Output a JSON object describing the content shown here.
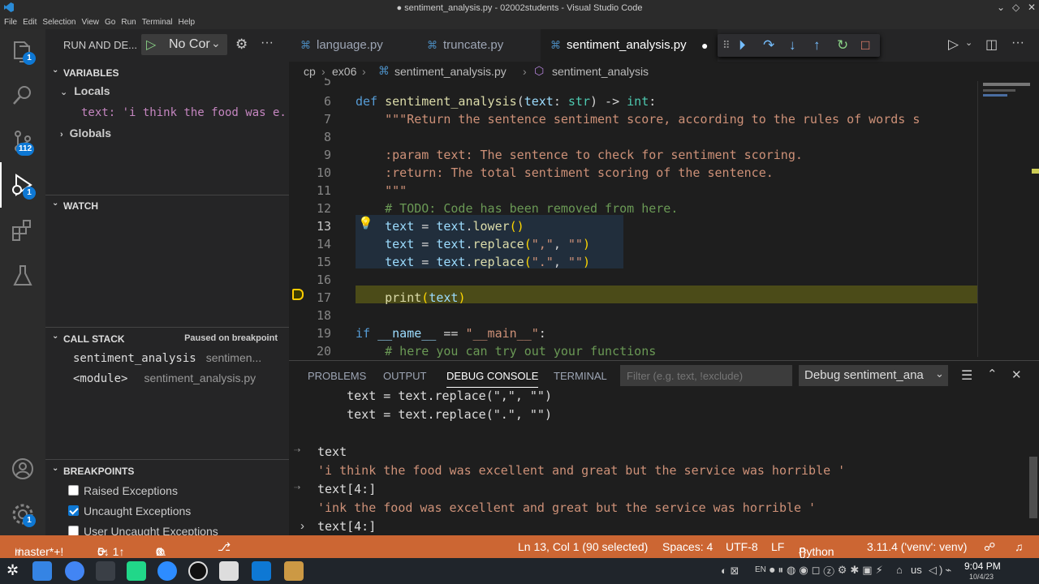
{
  "window": {
    "title": "● sentiment_analysis.py - 02002students - Visual Studio Code"
  },
  "menu": [
    "File",
    "Edit",
    "Selection",
    "View",
    "Go",
    "Run",
    "Terminal",
    "Help"
  ],
  "activity": {
    "explorer_badge": "1",
    "scm_badge": "112",
    "debug_badge": "1",
    "settings_badge": "1"
  },
  "sidebar": {
    "run_title": "RUN AND DE...",
    "config": "No Cor",
    "variables_header": "VARIABLES",
    "locals_label": "Locals",
    "local_var": "text: 'i think the food was e...",
    "globals_label": "Globals",
    "watch_header": "WATCH",
    "callstack_header": "CALL STACK",
    "callstack_status": "Paused on breakpoint",
    "frames": [
      {
        "name": "sentiment_analysis",
        "file": "sentimen..."
      },
      {
        "name": "<module>",
        "file": "sentiment_analysis.py"
      }
    ],
    "breakpoints_header": "BREAKPOINTS",
    "breakpoints": [
      {
        "label": "Raised Exceptions",
        "checked": false
      },
      {
        "label": "Uncaught Exceptions",
        "checked": true
      },
      {
        "label": "User Uncaught Exceptions",
        "checked": false
      }
    ]
  },
  "tabs": [
    {
      "label": "language.py"
    },
    {
      "label": "truncate.py"
    },
    {
      "label": "sentiment_analysis.py"
    }
  ],
  "breadcrumb": {
    "p1": "cp",
    "p2": "ex06",
    "p3": "sentiment_analysis.py",
    "p4": "sentiment_analysis"
  },
  "editor": {
    "lines": [
      {
        "n": "5",
        "html": ""
      },
      {
        "n": "6",
        "html": "<span class='kw'>def</span> <span class='fn'>sentiment_analysis</span>(<span class='pa'>text</span>: <span class='ty'>str</span>) -> <span class='ty'>int</span>:"
      },
      {
        "n": "7",
        "html": "    <span class='st'>\"\"\"Return the sentence sentiment score, according to the rules of words s</span>"
      },
      {
        "n": "8",
        "html": ""
      },
      {
        "n": "9",
        "html": "    <span class='st'>:param text: The sentence to check for sentiment scoring.</span>"
      },
      {
        "n": "10",
        "html": "    <span class='st'>:return: The total sentiment scoring of the sentence.</span>"
      },
      {
        "n": "11",
        "html": "    <span class='st'>\"\"\"</span>"
      },
      {
        "n": "12",
        "html": "    <span class='cm'># TODO: Code has been removed from here.</span>"
      },
      {
        "n": "13",
        "html": "    <span class='pa'>text</span> = <span class='pa'>text</span>.<span class='fn'>lower</span><span class='yl'>()</span>"
      },
      {
        "n": "14",
        "html": "    <span class='pa'>text</span> = <span class='pa'>text</span>.<span class='fn'>replace</span><span class='yl'>(</span><span class='st'>\",\"</span>, <span class='st'>\"\"</span><span class='yl'>)</span>"
      },
      {
        "n": "15",
        "html": "    <span class='pa'>text</span> = <span class='pa'>text</span>.<span class='fn'>replace</span><span class='yl'>(</span><span class='st'>\".\"</span>, <span class='st'>\"\"</span><span class='yl'>)</span>"
      },
      {
        "n": "16",
        "html": ""
      },
      {
        "n": "17",
        "html": "    <span class='fn'>print</span><span class='yl'>(</span><span class='pa'>text</span><span class='yl'>)</span>"
      },
      {
        "n": "18",
        "html": ""
      },
      {
        "n": "19",
        "html": "<span class='kw'>if</span> <span class='pa'>__name__</span> == <span class='st'>\"__main__\"</span>:"
      },
      {
        "n": "20",
        "html": "    <span class='cm'># here you can try out your functions</span>"
      }
    ]
  },
  "panel": {
    "tabs": [
      "PROBLEMS",
      "OUTPUT",
      "DEBUG CONSOLE",
      "TERMINAL"
    ],
    "filter_placeholder": "Filter (e.g. text, !exclude)",
    "session": "Debug sentiment_ana",
    "console": [
      {
        "kind": "echo",
        "text": "    text = text.replace(\",\", \"\")"
      },
      {
        "kind": "echo",
        "text": "    text = text.replace(\".\", \"\")"
      },
      {
        "kind": "blank",
        "text": ""
      },
      {
        "kind": "input",
        "text": "text"
      },
      {
        "kind": "result",
        "text": "'i think the food was excellent and great but the service was horrible '"
      },
      {
        "kind": "input",
        "text": "text[4:]"
      },
      {
        "kind": "result",
        "text": "'ink the food was excellent and great but the service was horrible '"
      }
    ],
    "prompt": "text[4:]"
  },
  "status": {
    "branch": "master*+!",
    "sync": "5↓ 1↑",
    "problems": "0",
    "warnings": "0",
    "cursor": "Ln 13, Col 1 (90 selected)",
    "spaces": "Spaces: 4",
    "encoding": "UTF-8",
    "eol": "LF",
    "language": "Python",
    "interpreter": "3.11.4 ('venv': venv)"
  },
  "taskbar": {
    "lang": "EN",
    "locale": "us",
    "time": "9:04 PM",
    "date": "10/4/23"
  },
  "colors": {
    "statusbar": "#cc6633",
    "accent": "#0e78d4",
    "current_line": "#4b4b18"
  }
}
